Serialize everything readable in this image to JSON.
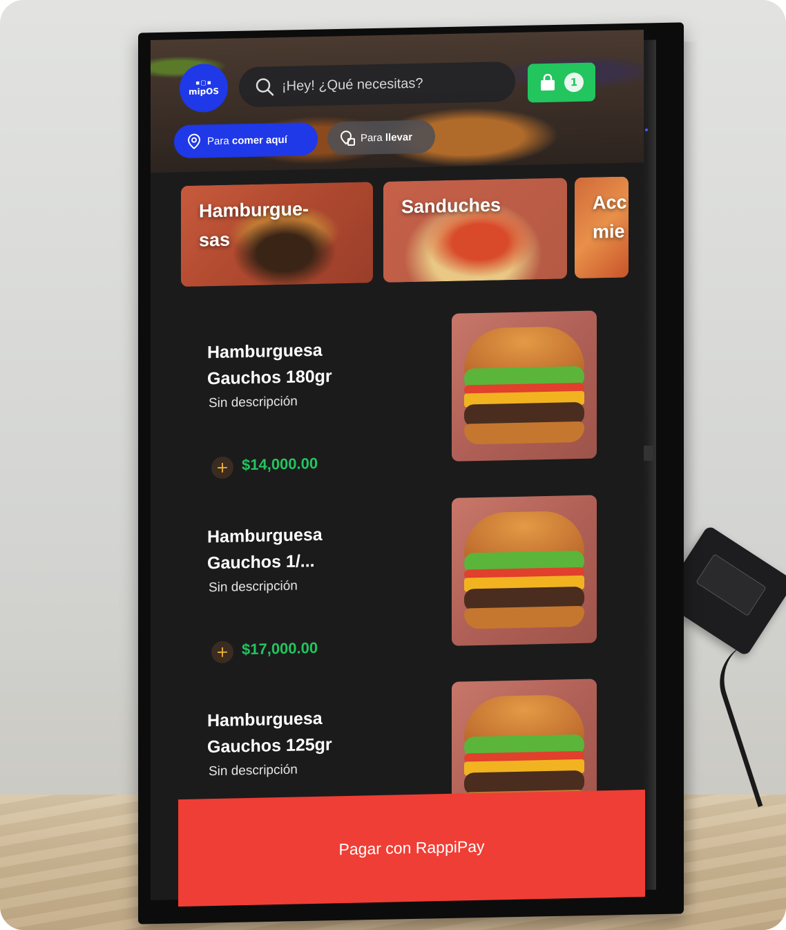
{
  "header": {
    "logo_text": "mipOS",
    "search_placeholder": "¡Hey! ¿Qué necesitas?",
    "cart_count": "1",
    "order_modes": [
      {
        "prefix": "Para",
        "bold": "comer aquí",
        "selected": true
      },
      {
        "prefix": "Para",
        "bold": "llevar",
        "selected": false
      }
    ]
  },
  "categories": [
    {
      "label": "Hamburgue-\nsas"
    },
    {
      "label": "Sanduches"
    },
    {
      "label": "Acc\nmie"
    }
  ],
  "products": [
    {
      "name": "Hamburguesa Gauchos 180gr",
      "description": "Sin descripción",
      "price": "$14,000.00"
    },
    {
      "name": "Hamburguesa Gauchos 1/...",
      "description": "Sin descripción",
      "price": "$17,000.00"
    },
    {
      "name": "Hamburguesa Gauchos 125gr",
      "description": "Sin descripción",
      "price": ""
    }
  ],
  "footer": {
    "pay_button": "Pagar con RappiPay"
  },
  "colors": {
    "brand_blue": "#1f38e8",
    "cart_green": "#22c55e",
    "price_green": "#22c55e",
    "pay_red": "#ef3e35",
    "add_icon": "#f3b23a"
  },
  "icons": {
    "search": "search-icon",
    "cart": "shopping-bag-icon",
    "dine_in": "location-pin-icon",
    "takeaway": "takeaway-bag-icon",
    "add": "plus-icon"
  }
}
